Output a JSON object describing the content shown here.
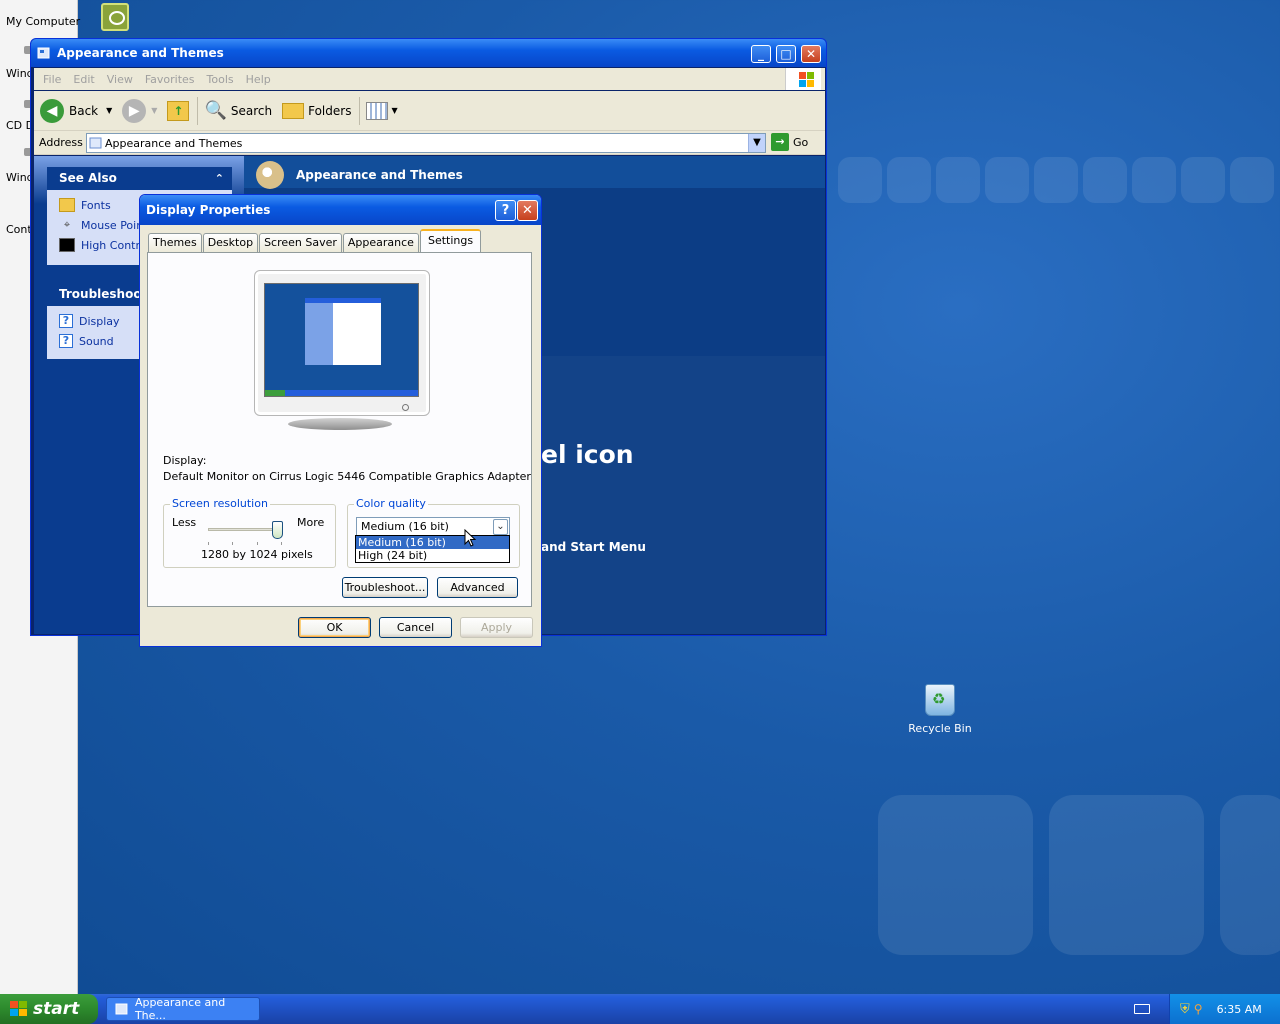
{
  "desktop": {
    "left_icons": [
      "My Computer",
      "Wind",
      "CD D",
      "Wind",
      "Cont"
    ],
    "recycle_bin": "Recycle Bin"
  },
  "explorer": {
    "title": "Appearance and Themes",
    "menu": [
      "File",
      "Edit",
      "View",
      "Favorites",
      "Tools",
      "Help"
    ],
    "toolbar": {
      "back": "Back",
      "search": "Search",
      "folders": "Folders"
    },
    "address_label": "Address",
    "address_value": "Appearance and Themes",
    "go": "Go",
    "see_also": {
      "title": "See Also",
      "items": [
        "Fonts",
        "Mouse Pointers",
        "High Contrast"
      ]
    },
    "troubleshooters": {
      "title": "Troubleshooters",
      "items": [
        "Display",
        "Sound"
      ]
    },
    "main_header": "Appearance and Themes",
    "main_big_text": "el icon",
    "main_mid_text": "and Start Menu"
  },
  "dialog": {
    "title": "Display Properties",
    "tabs": [
      "Themes",
      "Desktop",
      "Screen Saver",
      "Appearance",
      "Settings"
    ],
    "active_tab": "Settings",
    "display_label": "Display:",
    "display_value": "Default Monitor on Cirrus Logic 5446 Compatible Graphics Adapter",
    "screen_resolution": {
      "title": "Screen resolution",
      "less": "Less",
      "more": "More",
      "value_text": "1280 by 1024 pixels",
      "slider_level": 1.0
    },
    "color_quality": {
      "title": "Color quality",
      "selected": "Medium (16 bit)",
      "options": [
        "Medium (16 bit)",
        "High (24 bit)"
      ]
    },
    "buttons": {
      "troubleshoot": "Troubleshoot...",
      "advanced": "Advanced",
      "ok": "OK",
      "cancel": "Cancel",
      "apply": "Apply"
    }
  },
  "taskbar": {
    "start": "start",
    "task": "Appearance and The...",
    "clock": "6:35 AM"
  },
  "colors": {
    "xp_blue": "#0a5be2",
    "desktop_bg": "#1a5aa8",
    "start_green": "#3c9d3c"
  }
}
